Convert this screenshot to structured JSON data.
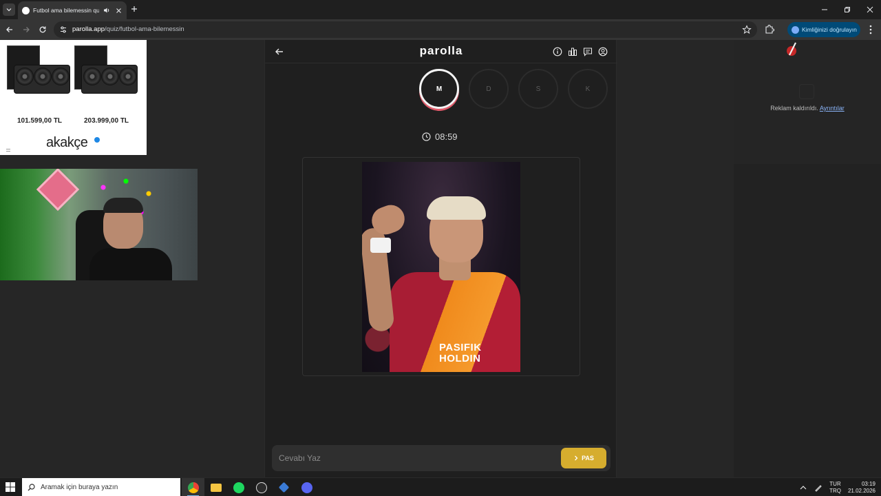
{
  "browser": {
    "tab_title": "Futbol ama bilemessin quiz",
    "url_host": "parolla.app",
    "url_path": "/quiz/futbol-ama-bilemessin",
    "verify_label": "Kimliğinizi doğrulayın"
  },
  "left_ad": {
    "prices": [
      "101.599,00 TL",
      "203.999,00 TL"
    ],
    "brand": "akakçe"
  },
  "quiz": {
    "logo": "parolla",
    "letters": [
      {
        "label": "M",
        "active": true
      },
      {
        "label": "D",
        "active": false
      },
      {
        "label": "S",
        "active": false
      },
      {
        "label": "K",
        "active": false
      }
    ],
    "timer": "08:59",
    "photo_sponsor_line1": "PASIFIK",
    "photo_sponsor_line2": "HOLDIN",
    "answer_placeholder": "Cevabı Yaz",
    "pass_label": "PAS"
  },
  "right_ad": {
    "removed_text": "Reklam kaldırıldı.",
    "details_link": "Ayrıntılar"
  },
  "taskbar": {
    "search_placeholder": "Aramak için buraya yazın",
    "lang_line1": "TUR",
    "lang_line2": "TRQ",
    "time": "03:19",
    "date": "21.02.2026"
  },
  "colors": {
    "pass_button": "#d6ad2e",
    "active_letter_ring": "#f4f4f4",
    "active_letter_accent": "#e25a6a",
    "verify_pill": "#004a77"
  },
  "icons": [
    "back-arrow-icon",
    "info-icon",
    "chart-icon",
    "message-icon",
    "account-icon",
    "clock-icon",
    "chevron-right-icon",
    "star-icon",
    "puzzle-icon",
    "windows-icon",
    "search-icon"
  ]
}
